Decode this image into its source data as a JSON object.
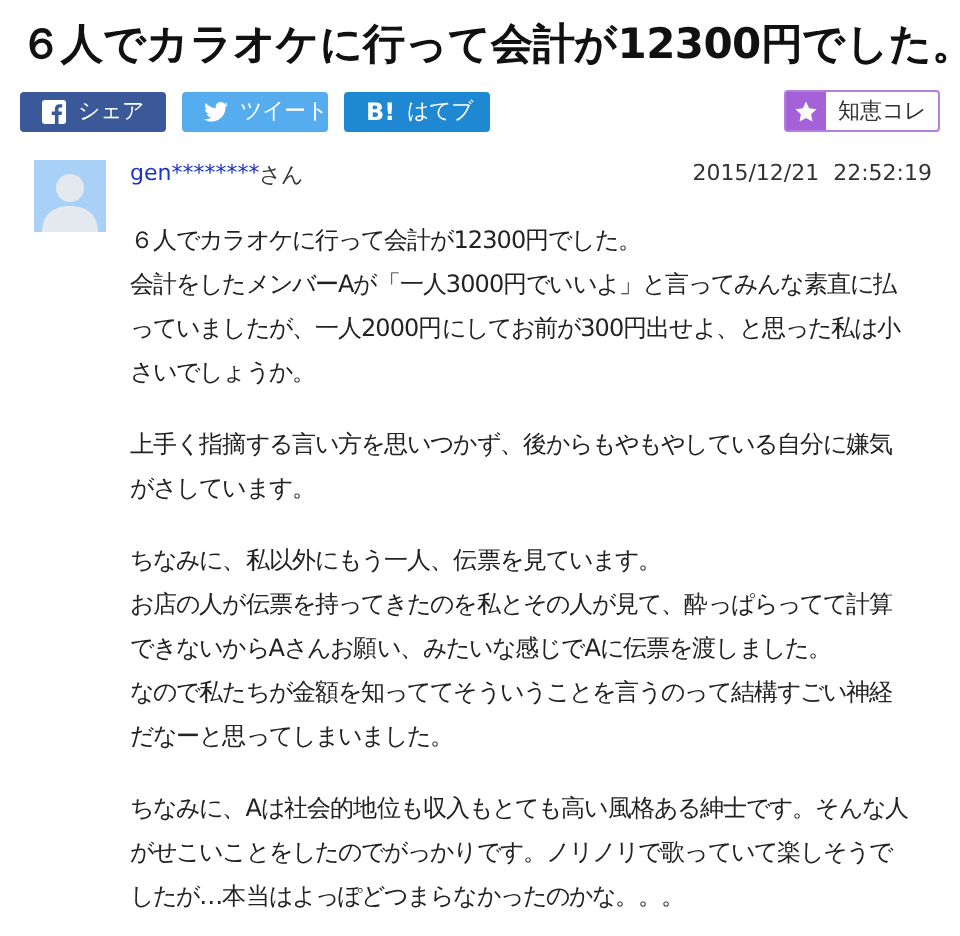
{
  "title": "６人でカラオケに行って会計が12300円でした。",
  "share_buttons": [
    {
      "kind": "facebook",
      "label": "シェア"
    },
    {
      "kind": "twitter",
      "label": "ツイート"
    },
    {
      "kind": "hatena",
      "mark": "B!",
      "label": "はてブ"
    }
  ],
  "chiekore_button": {
    "label": "知恵コレ"
  },
  "question": {
    "user": "gen********",
    "honorific": "さん",
    "date": "2015/12/21  22:52:19",
    "paragraphs": [
      [
        "６人でカラオケに行って会計が12300円でした。",
        "会計をしたメンバーAが「一人3000円でいいよ」と言ってみんな素直に払",
        "っていましたが、一人2000円にしてお前が300円出せよ、と思った私は小",
        "さいでしょうか。"
      ],
      [
        "上手く指摘する言い方を思いつかず、後からもやもやしている自分に嫌気",
        "がさしています。"
      ],
      [
        "ちなみに、私以外にもう一人、伝票を見ています。",
        "お店の人が伝票を持ってきたのを私とその人が見て、酔っぱらってて計算",
        "できないからAさんお願い、みたいな感じでAに伝票を渡しました。",
        "なので私たちが金額を知っててそういうことを言うのって結構すごい神経",
        "だなーと思ってしまいました。"
      ],
      [
        "ちなみに、Aは社会的地位も収入もとても高い風格ある紳士です。そんな人",
        "がせこいことをしたのでがっかりです。ノリノリで歌っていて楽しそうで",
        "したが…本当はよっぽどつまらなかったのかな。。。"
      ]
    ]
  }
}
